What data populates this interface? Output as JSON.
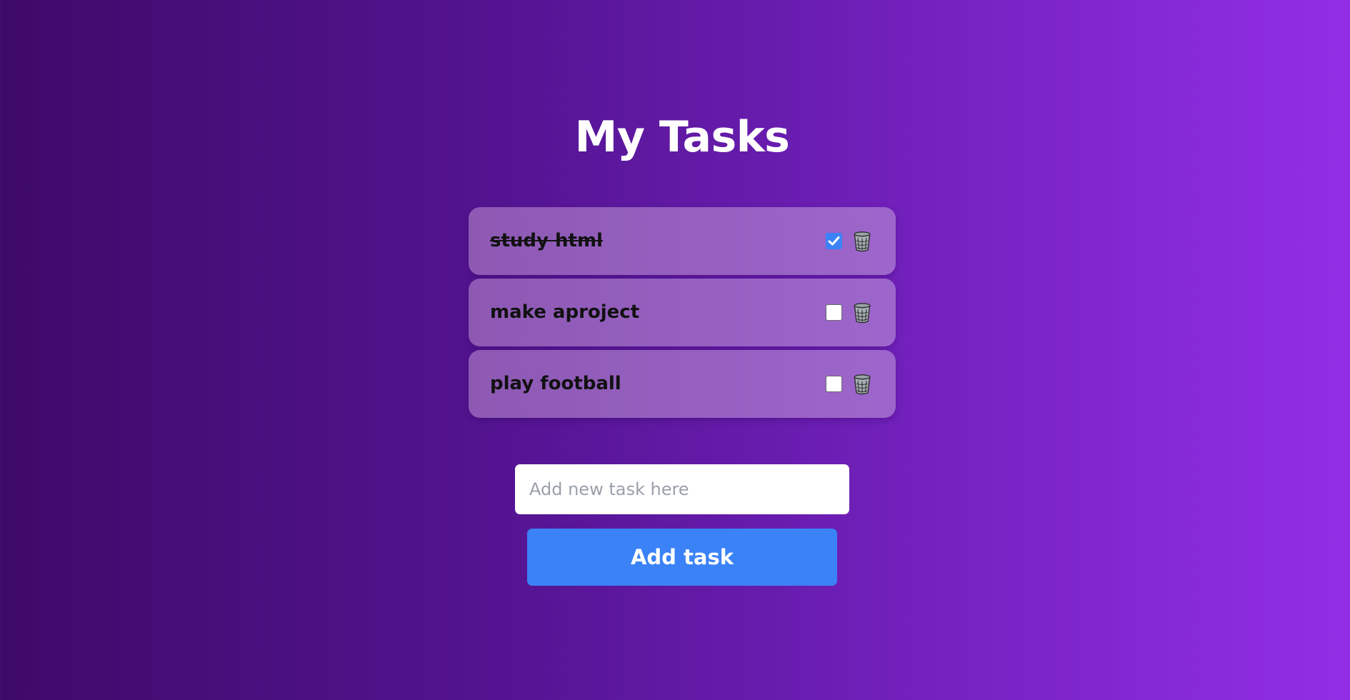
{
  "page": {
    "title": "My Tasks"
  },
  "colors": {
    "accent": "#3b82f6",
    "background_start": "#3e0a68",
    "background_end": "#922ee6",
    "card": "#9563c0"
  },
  "tasks": [
    {
      "label": "study html",
      "done": true
    },
    {
      "label": "make aproject",
      "done": false
    },
    {
      "label": "play football",
      "done": false
    }
  ],
  "icons": {
    "delete": "trash-icon",
    "checkmark": "checkmark-icon"
  },
  "form": {
    "placeholder": "Add new task here",
    "value": "",
    "add_label": "Add task"
  }
}
